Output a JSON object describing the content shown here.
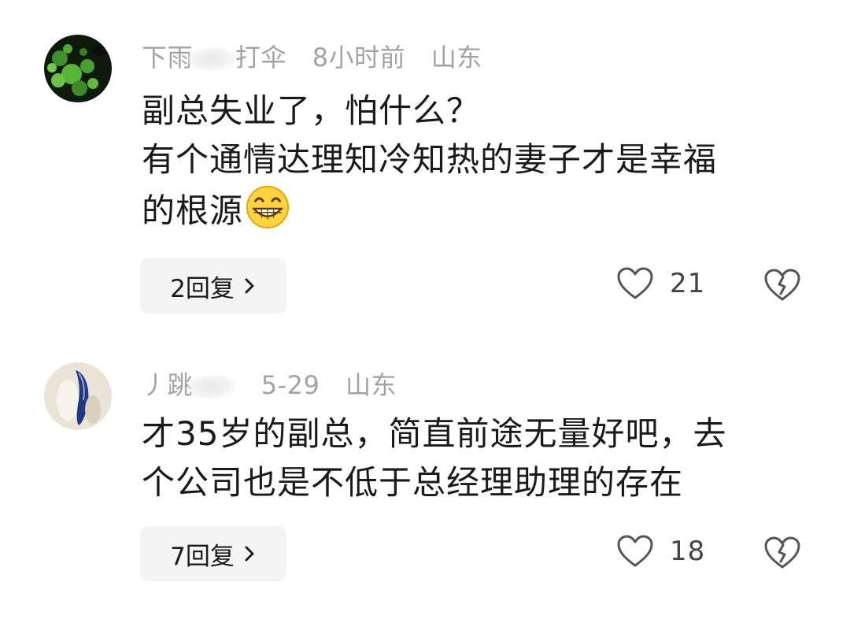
{
  "comments": [
    {
      "username_prefix": "下雨",
      "username_suffix": "打伞",
      "time": "8小时前",
      "location": "山东",
      "lines": [
        "副总失业了，怕什么？",
        "有个通情达理知冷知热的妻子才是幸福",
        "的根源"
      ],
      "emoji": "grinning-face-emoji",
      "reply_label": "2回复",
      "like_count": "21"
    },
    {
      "username_prefix": "丿跳",
      "username_suffix": "",
      "time": "5-29",
      "location": "山东",
      "lines": [
        "才35岁的副总，简直前途无量好吧，去",
        "个公司也是不低于总经理助理的存在"
      ],
      "reply_label": "7回复",
      "like_count": "18"
    }
  ],
  "icons": {
    "like": "heart-outline-icon",
    "dislike": "broken-heart-icon",
    "reply_chevron": "chevron-right-icon"
  },
  "colors": {
    "meta_text": "#a3a3a3",
    "body_text": "#1a1a1a",
    "reply_bg": "#f4f4f4",
    "icon_stroke": "#555555"
  }
}
